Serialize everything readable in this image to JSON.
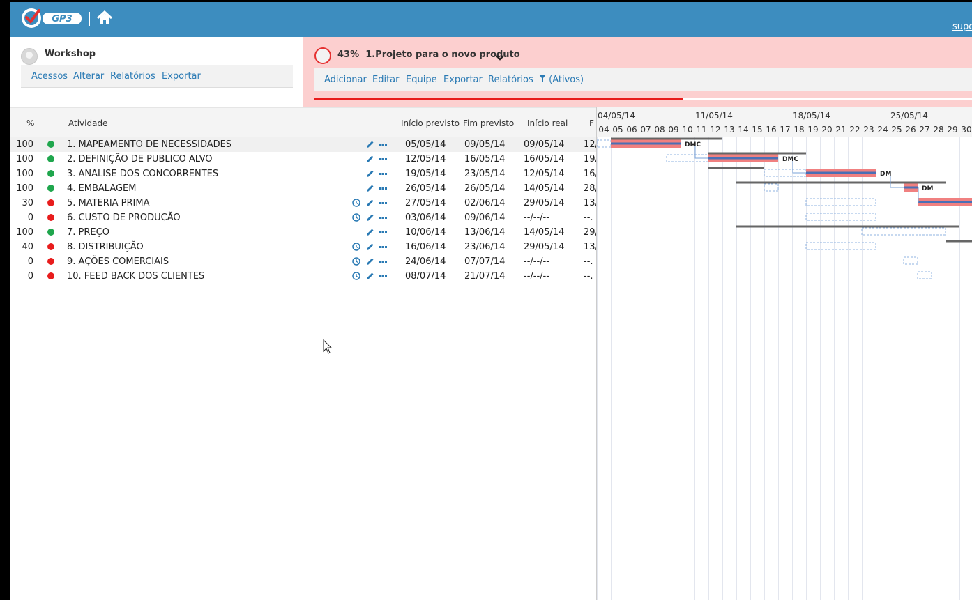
{
  "header": {
    "logo_text": "GP3",
    "support_text": "supo"
  },
  "workspace": {
    "name": "Workshop",
    "menu": [
      "Acessos",
      "Alterar",
      "Relatórios",
      "Exportar"
    ]
  },
  "project": {
    "percent": "43%",
    "title": "1.Projeto para o novo produto",
    "progress": 0.56,
    "menu": [
      "Adicionar",
      "Editar",
      "Equipe",
      "Exportar",
      "Relatórios"
    ],
    "filter_label": "(Ativos)",
    "accent_color": "#e81c1c"
  },
  "table": {
    "headers": {
      "percent": "%",
      "activity": "Atividade",
      "planned_start": "Início previsto",
      "planned_end": "Fim previsto",
      "actual_start": "Início real",
      "actual_end": "F"
    },
    "rows": [
      {
        "pct": "100",
        "status": "green",
        "name": "1. MAPEAMENTO DE NECESSIDADES",
        "clock": false,
        "ps": "05/05/14",
        "pe": "09/05/14",
        "as": "09/05/14",
        "ae": "12/"
      },
      {
        "pct": "100",
        "status": "green",
        "name": "2. DEFINIÇÃO DE PUBLICO ALVO",
        "clock": false,
        "ps": "12/05/14",
        "pe": "16/05/14",
        "as": "16/05/14",
        "ae": "19/"
      },
      {
        "pct": "100",
        "status": "green",
        "name": "3. ANALISE DOS CONCORRENTES",
        "clock": false,
        "ps": "19/05/14",
        "pe": "23/05/14",
        "as": "12/05/14",
        "ae": "16/"
      },
      {
        "pct": "100",
        "status": "green",
        "name": "4. EMBALAGEM",
        "clock": false,
        "ps": "26/05/14",
        "pe": "26/05/14",
        "as": "14/05/14",
        "ae": "28/"
      },
      {
        "pct": "30",
        "status": "red",
        "name": "5. MATERIA PRIMA",
        "clock": true,
        "ps": "27/05/14",
        "pe": "02/06/14",
        "as": "29/05/14",
        "ae": "13/"
      },
      {
        "pct": "0",
        "status": "red",
        "name": "6. CUSTO DE PRODUÇÃO",
        "clock": true,
        "ps": "03/06/14",
        "pe": "09/06/14",
        "as": "--/--/--",
        "ae": "--."
      },
      {
        "pct": "100",
        "status": "green",
        "name": "7. PREÇO",
        "clock": false,
        "ps": "10/06/14",
        "pe": "13/06/14",
        "as": "14/05/14",
        "ae": "29/"
      },
      {
        "pct": "40",
        "status": "red",
        "name": "8. DISTRIBUIÇÃO",
        "clock": true,
        "ps": "16/06/14",
        "pe": "23/06/14",
        "as": "29/05/14",
        "ae": "13/"
      },
      {
        "pct": "0",
        "status": "red",
        "name": "9. AÇÕES COMERCIAIS",
        "clock": true,
        "ps": "24/06/14",
        "pe": "07/07/14",
        "as": "--/--/--",
        "ae": "--."
      },
      {
        "pct": "0",
        "status": "red",
        "name": "10. FEED BACK DOS CLIENTES",
        "clock": true,
        "ps": "08/07/14",
        "pe": "21/07/14",
        "as": "--/--/--",
        "ae": "--."
      }
    ]
  },
  "gantt": {
    "weeks": [
      "04/05/14",
      "11/05/14",
      "18/05/14",
      "25/05/14"
    ],
    "days": [
      "04",
      "05",
      "06",
      "07",
      "08",
      "09",
      "10",
      "11",
      "12",
      "13",
      "14",
      "15",
      "16",
      "17",
      "18",
      "19",
      "20",
      "21",
      "22",
      "23",
      "24",
      "25",
      "26",
      "27",
      "28",
      "29",
      "30"
    ],
    "labels": [
      "DMC",
      "DMC",
      "DM",
      "DM"
    ]
  },
  "colors": {
    "header_blue": "#3d8dbf",
    "project_pink": "#fccfcf",
    "status_green": "#1fa64d",
    "status_red": "#e81c1c",
    "link_blue": "#2a7ab4"
  }
}
